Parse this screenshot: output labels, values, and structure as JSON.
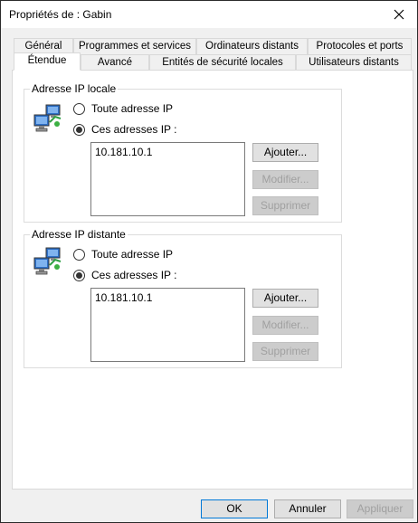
{
  "window": {
    "title": "Propriétés de : Gabin"
  },
  "tabs_row1": [
    {
      "label": "Général"
    },
    {
      "label": "Programmes et services"
    },
    {
      "label": "Ordinateurs distants"
    },
    {
      "label": "Protocoles et ports"
    }
  ],
  "tabs_row2": [
    {
      "label": "Étendue",
      "active": true
    },
    {
      "label": "Avancé"
    },
    {
      "label": "Entités de sécurité locales"
    },
    {
      "label": "Utilisateurs distants"
    }
  ],
  "local_group": {
    "legend": "Adresse IP locale",
    "icon": "network-computers-icon",
    "option_any": "Toute adresse IP",
    "option_these": "Ces adresses IP :",
    "selected": "these",
    "addresses": [
      "10.181.10.1"
    ],
    "add_label": "Ajouter...",
    "modify_label": "Modifier...",
    "remove_label": "Supprimer"
  },
  "remote_group": {
    "legend": "Adresse IP distante",
    "icon": "network-computers-icon",
    "option_any": "Toute adresse IP",
    "option_these": "Ces adresses IP :",
    "selected": "these",
    "addresses": [
      "10.181.10.1"
    ],
    "add_label": "Ajouter...",
    "modify_label": "Modifier...",
    "remove_label": "Supprimer"
  },
  "footer": {
    "ok_label": "OK",
    "cancel_label": "Annuler",
    "apply_label": "Appliquer"
  },
  "colors": {
    "primary_border": "#0078d7",
    "disabled_text": "#a0a0a0"
  }
}
